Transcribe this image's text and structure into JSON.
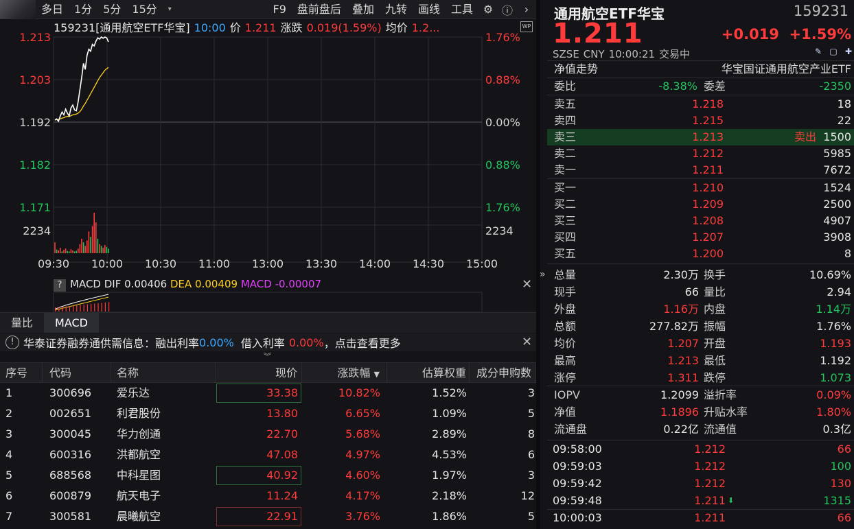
{
  "toolbar": {
    "periods": [
      "多日",
      "1分",
      "5分",
      "15分"
    ],
    "right_items": [
      "F9",
      "盘前盘后",
      "叠加",
      "九转",
      "画线",
      "工具"
    ]
  },
  "chart_header": {
    "symbol": "159231[通用航空ETF华宝]",
    "time": "10:00",
    "price_label": "价",
    "price": "1.211",
    "change_label": "涨跌",
    "change": "0.019(1.59%)",
    "avg_label": "均价",
    "avg": "1.2..."
  },
  "chart_data": {
    "type": "line",
    "y_left_ticks": [
      "1.213",
      "1.203",
      "1.192",
      "1.182",
      "1.171"
    ],
    "y_right_ticks": [
      "1.76%",
      "0.88%",
      "0.00%",
      "0.88%",
      "1.76%"
    ],
    "volume_tick": "2234",
    "x_ticks": [
      "09:30",
      "10:00",
      "10:30",
      "11:00",
      "13:00",
      "13:30",
      "14:00",
      "14:30",
      "15:00"
    ],
    "ylim": [
      1.171,
      1.213
    ],
    "price_series": [
      1.1925,
      1.1928,
      1.1922,
      1.1935,
      1.1945,
      1.1938,
      1.1952,
      1.1942,
      1.1935,
      1.1955,
      1.1962,
      1.195,
      1.1948,
      1.197,
      1.2,
      1.203,
      1.2065,
      1.205,
      1.2085,
      1.21,
      1.2095,
      1.2112,
      1.2108,
      1.212,
      1.2128,
      1.2125,
      1.213,
      1.2127,
      1.213,
      1.2128,
      1.2118
    ],
    "avg_series": [
      1.1925,
      1.1927,
      1.1926,
      1.1928,
      1.193,
      1.1931,
      1.1933,
      1.1934,
      1.1934,
      1.1936,
      1.1938,
      1.1939,
      1.194,
      1.1942,
      1.1946,
      1.1952,
      1.196,
      1.1966,
      1.1974,
      1.1982,
      1.199,
      1.1998,
      1.2006,
      1.2014,
      1.2022,
      1.203,
      1.2036,
      1.2042,
      1.2048,
      1.2052,
      1.2055
    ],
    "volume_series": [
      600,
      200,
      150,
      300,
      100,
      180,
      260,
      120,
      90,
      220,
      150,
      100,
      130,
      250,
      500,
      800,
      600,
      400,
      700,
      1200,
      900,
      1500,
      2234,
      1700,
      800,
      500,
      400,
      300,
      450,
      350,
      250
    ],
    "volume_up": [
      true,
      false,
      true,
      true,
      false,
      true,
      true,
      false,
      false,
      true,
      true,
      false,
      false,
      true,
      true,
      true,
      false,
      true,
      true,
      true,
      false,
      true,
      true,
      true,
      false,
      true,
      false,
      true,
      true,
      false,
      false
    ],
    "volume_max": 2234,
    "macd": {
      "label": "MACD",
      "dif_label": "DIF",
      "dif": "0.00406",
      "dea_label": "DEA",
      "dea": "0.00409",
      "macd_label": "MACD",
      "macd": "-0.00007"
    }
  },
  "tabs": [
    "量比",
    "MACD"
  ],
  "notice": {
    "text1": "华泰证券融券通供需信息：融出利率",
    "rate1": "0.00%",
    "text2": "借入利率",
    "rate2": "0.00%",
    "text3": "，点击查看更多"
  },
  "table": {
    "headers": [
      "序号",
      "代码",
      "名称",
      "现价",
      "涨跌幅",
      "估算权重",
      "成分申购数"
    ],
    "rows": [
      {
        "seq": "1",
        "code": "300696",
        "name": "爱乐达",
        "price": "33.38",
        "pct": "10.82%",
        "weight": "1.52%",
        "sub": "3",
        "box": "green"
      },
      {
        "seq": "2",
        "code": "002651",
        "name": "利君股份",
        "price": "13.80",
        "pct": "6.65%",
        "weight": "1.09%",
        "sub": "5",
        "box": ""
      },
      {
        "seq": "3",
        "code": "300045",
        "name": "华力创通",
        "price": "22.70",
        "pct": "5.68%",
        "weight": "2.89%",
        "sub": "8",
        "box": ""
      },
      {
        "seq": "4",
        "code": "600316",
        "name": "洪都航空",
        "price": "47.08",
        "pct": "4.97%",
        "weight": "4.53%",
        "sub": "6",
        "box": ""
      },
      {
        "seq": "5",
        "code": "688568",
        "name": "中科星图",
        "price": "40.92",
        "pct": "4.60%",
        "weight": "1.97%",
        "sub": "3",
        "box": "green"
      },
      {
        "seq": "6",
        "code": "600879",
        "name": "航天电子",
        "price": "11.24",
        "pct": "4.17%",
        "weight": "2.18%",
        "sub": "12",
        "box": ""
      },
      {
        "seq": "7",
        "code": "300581",
        "name": "晨曦航空",
        "price": "22.91",
        "pct": "3.76%",
        "weight": "1.86%",
        "sub": "5",
        "box": "red"
      }
    ]
  },
  "quote": {
    "name": "通用航空ETF华宝",
    "code": "159231",
    "price": "1.211",
    "change": "+0.019",
    "change_pct": "+1.59%",
    "exchange": "SZSE",
    "currency": "CNY",
    "time": "10:00:21",
    "status": "交易中",
    "nav_label": "净值走势",
    "fund_name": "华宝国证通用航空产业ETF",
    "wb_label": "委比",
    "wb_value": "-8.38%",
    "wc_label": "委差",
    "wc_value": "-2350"
  },
  "orderbook": {
    "asks": [
      {
        "label": "卖五",
        "price": "1.218",
        "vol": "18"
      },
      {
        "label": "卖四",
        "price": "1.215",
        "vol": "22"
      },
      {
        "label": "卖三",
        "price": "1.213",
        "vol": "1500",
        "tag": "卖出"
      },
      {
        "label": "卖二",
        "price": "1.212",
        "vol": "5985"
      },
      {
        "label": "卖一",
        "price": "1.211",
        "vol": "7672"
      }
    ],
    "bids": [
      {
        "label": "买一",
        "price": "1.210",
        "vol": "1524"
      },
      {
        "label": "买二",
        "price": "1.209",
        "vol": "2500"
      },
      {
        "label": "买三",
        "price": "1.208",
        "vol": "4907"
      },
      {
        "label": "买四",
        "price": "1.207",
        "vol": "3908"
      },
      {
        "label": "买五",
        "price": "1.200",
        "vol": "8"
      }
    ]
  },
  "stats": [
    {
      "l1": "总量",
      "v1": "2.30万",
      "c1": "white",
      "l2": "换手",
      "v2": "10.69%",
      "c2": "white"
    },
    {
      "l1": "现手",
      "v1": "66",
      "c1": "white",
      "l2": "量比",
      "v2": "2.94",
      "c2": "white"
    },
    {
      "l1": "外盘",
      "v1": "1.16万",
      "c1": "red",
      "l2": "内盘",
      "v2": "1.14万",
      "c2": "green"
    },
    {
      "l1": "总额",
      "v1": "277.82万",
      "c1": "white",
      "l2": "振幅",
      "v2": "1.76%",
      "c2": "white"
    },
    {
      "l1": "均价",
      "v1": "1.207",
      "c1": "red",
      "l2": "开盘",
      "v2": "1.193",
      "c2": "red"
    },
    {
      "l1": "最高",
      "v1": "1.213",
      "c1": "red",
      "l2": "最低",
      "v2": "1.192",
      "c2": "white"
    },
    {
      "l1": "涨停",
      "v1": "1.311",
      "c1": "red",
      "l2": "跌停",
      "v2": "1.073",
      "c2": "green"
    },
    {
      "l1": "IOPV",
      "v1": "1.2099",
      "c1": "white",
      "l2": "溢折率",
      "v2": "0.09%",
      "c2": "red"
    },
    {
      "l1": "净值",
      "v1": "1.1896",
      "c1": "red",
      "l2": "升贴水率",
      "v2": "1.80%",
      "c2": "red"
    },
    {
      "l1": "流通盘",
      "v1": "0.22亿",
      "c1": "white",
      "l2": "流通值",
      "v2": "0.3亿",
      "c2": "white"
    }
  ],
  "ticks": [
    {
      "time": "09:58:00",
      "price": "1.212",
      "vol": "66",
      "color": "red",
      "down": false
    },
    {
      "time": "09:59:03",
      "price": "1.212",
      "vol": "100",
      "color": "green",
      "down": false
    },
    {
      "time": "09:59:42",
      "price": "1.212",
      "vol": "130",
      "color": "red",
      "down": false
    },
    {
      "time": "09:59:48",
      "price": "1.211",
      "vol": "1315",
      "color": "green",
      "down": true
    },
    {
      "time": "10:00:03",
      "price": "1.211",
      "vol": "66",
      "color": "red",
      "down": false
    }
  ],
  "colors": {
    "up": "#ff3b3b",
    "down": "#22c55e",
    "avg_line": "#ffd21f",
    "price_line": "#ffffff",
    "macd": "#e040fb",
    "dea": "#ffd21f"
  }
}
